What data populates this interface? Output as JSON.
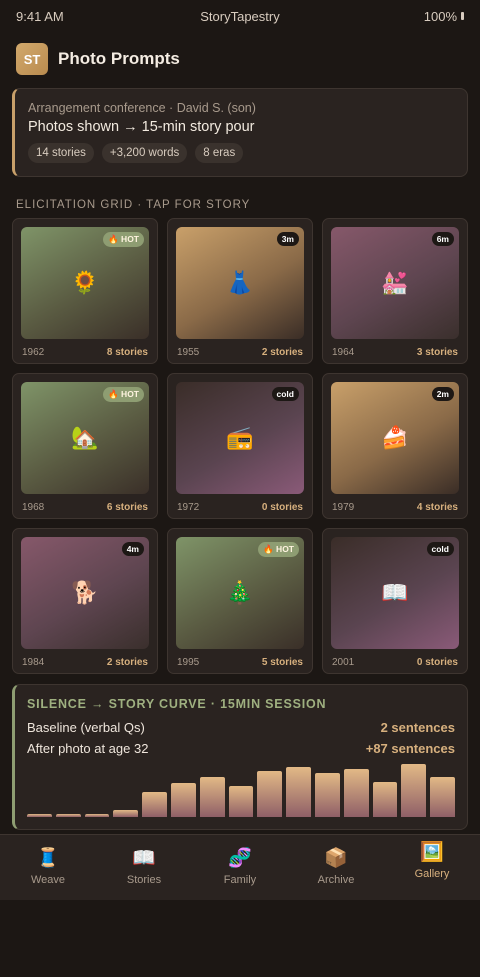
{
  "status_bar": {
    "time": "9:41 AM",
    "app_name": "StoryTapestry",
    "battery": "100%"
  },
  "header": {
    "logo_text": "ST",
    "title": "Photo Prompts"
  },
  "session": {
    "subtitle": "Arrangement conference · David S. (son)",
    "title": "Photos shown → 15-min story pour",
    "chips": [
      "14 stories",
      "+3,200 words",
      "8 eras"
    ]
  },
  "grid_label": "ELICITATION GRID · TAP FOR STORY",
  "tiles": [
    {
      "year": "1962",
      "stories": "8 stories",
      "badge": "🔥 HOT",
      "badge_type": "hot",
      "emoji": "🌻",
      "tone": "green"
    },
    {
      "year": "1955",
      "stories": "2 stories",
      "badge": "3m",
      "badge_type": "time",
      "emoji": "👗",
      "tone": "tan"
    },
    {
      "year": "1964",
      "stories": "3 stories",
      "badge": "6m",
      "badge_type": "time",
      "emoji": "💒",
      "tone": "mauve"
    },
    {
      "year": "1968",
      "stories": "6 stories",
      "badge": "🔥 HOT",
      "badge_type": "hot",
      "emoji": "🏡",
      "tone": "green"
    },
    {
      "year": "1972",
      "stories": "0 stories",
      "badge": "cold",
      "badge_type": "cold",
      "emoji": "📻",
      "tone": "dark-mauve"
    },
    {
      "year": "1979",
      "stories": "4 stories",
      "badge": "2m",
      "badge_type": "time",
      "emoji": "🍰",
      "tone": "tan"
    },
    {
      "year": "1984",
      "stories": "2 stories",
      "badge": "4m",
      "badge_type": "time",
      "emoji": "🐕",
      "tone": "mauve"
    },
    {
      "year": "1995",
      "stories": "5 stories",
      "badge": "🔥 HOT",
      "badge_type": "hot",
      "emoji": "🎄",
      "tone": "green"
    },
    {
      "year": "2001",
      "stories": "0 stories",
      "badge": "cold",
      "badge_type": "cold",
      "emoji": "📖",
      "tone": "dark-mauve"
    }
  ],
  "curve": {
    "title": "SILENCE → STORY CURVE · 15MIN SESSION",
    "rows": [
      {
        "label": "Baseline (verbal Qs)",
        "value": "2 sentences"
      },
      {
        "label": "After photo at age 32",
        "value": "+87 sentences"
      }
    ],
    "bar_levels": [
      0.04,
      0.05,
      0.04,
      0.11,
      0.41,
      0.57,
      0.66,
      0.52,
      0.77,
      0.84,
      0.73,
      0.8,
      0.59,
      0.89,
      0.66
    ]
  },
  "tabs": [
    {
      "label": "Weave",
      "icon": "🧵",
      "icon_name": "thread-icon",
      "active": false
    },
    {
      "label": "Stories",
      "icon": "📖",
      "icon_name": "book-icon",
      "active": false
    },
    {
      "label": "Family",
      "icon": "🧬",
      "icon_name": "dna-icon",
      "active": false
    },
    {
      "label": "Archive",
      "icon": "📦",
      "icon_name": "box-icon",
      "active": false
    },
    {
      "label": "Gallery",
      "icon": "🖼️",
      "icon_name": "picture-icon",
      "active": true
    }
  ],
  "colors": {
    "accent_gold": "#d7b07e",
    "accent_green": "#9fb080",
    "background": "#1c1714",
    "card": "#2a2320"
  }
}
